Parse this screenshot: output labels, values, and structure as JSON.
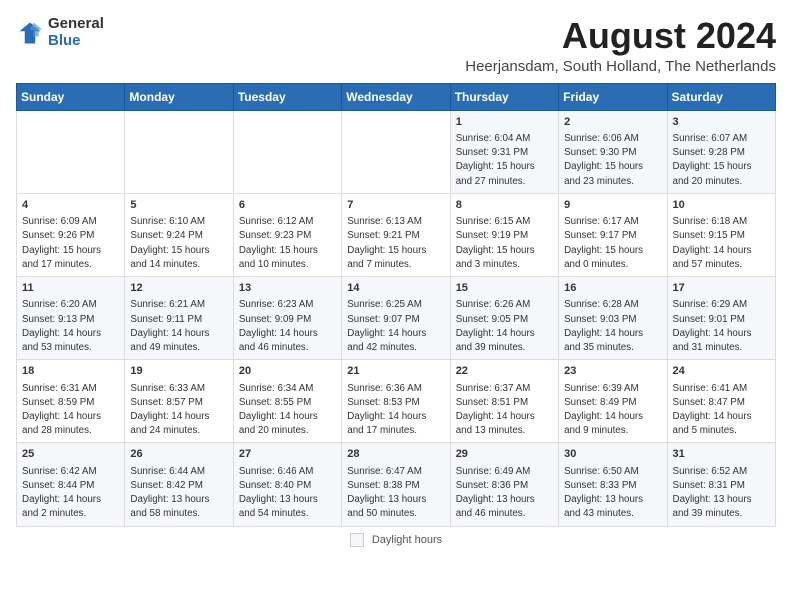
{
  "header": {
    "logo_general": "General",
    "logo_blue": "Blue",
    "month_title": "August 2024",
    "subtitle": "Heerjansdam, South Holland, The Netherlands"
  },
  "calendar": {
    "columns": [
      "Sunday",
      "Monday",
      "Tuesday",
      "Wednesday",
      "Thursday",
      "Friday",
      "Saturday"
    ],
    "weeks": [
      [
        {
          "day": "",
          "info": ""
        },
        {
          "day": "",
          "info": ""
        },
        {
          "day": "",
          "info": ""
        },
        {
          "day": "",
          "info": ""
        },
        {
          "day": "1",
          "info": "Sunrise: 6:04 AM\nSunset: 9:31 PM\nDaylight: 15 hours\nand 27 minutes."
        },
        {
          "day": "2",
          "info": "Sunrise: 6:06 AM\nSunset: 9:30 PM\nDaylight: 15 hours\nand 23 minutes."
        },
        {
          "day": "3",
          "info": "Sunrise: 6:07 AM\nSunset: 9:28 PM\nDaylight: 15 hours\nand 20 minutes."
        }
      ],
      [
        {
          "day": "4",
          "info": "Sunrise: 6:09 AM\nSunset: 9:26 PM\nDaylight: 15 hours\nand 17 minutes."
        },
        {
          "day": "5",
          "info": "Sunrise: 6:10 AM\nSunset: 9:24 PM\nDaylight: 15 hours\nand 14 minutes."
        },
        {
          "day": "6",
          "info": "Sunrise: 6:12 AM\nSunset: 9:23 PM\nDaylight: 15 hours\nand 10 minutes."
        },
        {
          "day": "7",
          "info": "Sunrise: 6:13 AM\nSunset: 9:21 PM\nDaylight: 15 hours\nand 7 minutes."
        },
        {
          "day": "8",
          "info": "Sunrise: 6:15 AM\nSunset: 9:19 PM\nDaylight: 15 hours\nand 3 minutes."
        },
        {
          "day": "9",
          "info": "Sunrise: 6:17 AM\nSunset: 9:17 PM\nDaylight: 15 hours\nand 0 minutes."
        },
        {
          "day": "10",
          "info": "Sunrise: 6:18 AM\nSunset: 9:15 PM\nDaylight: 14 hours\nand 57 minutes."
        }
      ],
      [
        {
          "day": "11",
          "info": "Sunrise: 6:20 AM\nSunset: 9:13 PM\nDaylight: 14 hours\nand 53 minutes."
        },
        {
          "day": "12",
          "info": "Sunrise: 6:21 AM\nSunset: 9:11 PM\nDaylight: 14 hours\nand 49 minutes."
        },
        {
          "day": "13",
          "info": "Sunrise: 6:23 AM\nSunset: 9:09 PM\nDaylight: 14 hours\nand 46 minutes."
        },
        {
          "day": "14",
          "info": "Sunrise: 6:25 AM\nSunset: 9:07 PM\nDaylight: 14 hours\nand 42 minutes."
        },
        {
          "day": "15",
          "info": "Sunrise: 6:26 AM\nSunset: 9:05 PM\nDaylight: 14 hours\nand 39 minutes."
        },
        {
          "day": "16",
          "info": "Sunrise: 6:28 AM\nSunset: 9:03 PM\nDaylight: 14 hours\nand 35 minutes."
        },
        {
          "day": "17",
          "info": "Sunrise: 6:29 AM\nSunset: 9:01 PM\nDaylight: 14 hours\nand 31 minutes."
        }
      ],
      [
        {
          "day": "18",
          "info": "Sunrise: 6:31 AM\nSunset: 8:59 PM\nDaylight: 14 hours\nand 28 minutes."
        },
        {
          "day": "19",
          "info": "Sunrise: 6:33 AM\nSunset: 8:57 PM\nDaylight: 14 hours\nand 24 minutes."
        },
        {
          "day": "20",
          "info": "Sunrise: 6:34 AM\nSunset: 8:55 PM\nDaylight: 14 hours\nand 20 minutes."
        },
        {
          "day": "21",
          "info": "Sunrise: 6:36 AM\nSunset: 8:53 PM\nDaylight: 14 hours\nand 17 minutes."
        },
        {
          "day": "22",
          "info": "Sunrise: 6:37 AM\nSunset: 8:51 PM\nDaylight: 14 hours\nand 13 minutes."
        },
        {
          "day": "23",
          "info": "Sunrise: 6:39 AM\nSunset: 8:49 PM\nDaylight: 14 hours\nand 9 minutes."
        },
        {
          "day": "24",
          "info": "Sunrise: 6:41 AM\nSunset: 8:47 PM\nDaylight: 14 hours\nand 5 minutes."
        }
      ],
      [
        {
          "day": "25",
          "info": "Sunrise: 6:42 AM\nSunset: 8:44 PM\nDaylight: 14 hours\nand 2 minutes."
        },
        {
          "day": "26",
          "info": "Sunrise: 6:44 AM\nSunset: 8:42 PM\nDaylight: 13 hours\nand 58 minutes."
        },
        {
          "day": "27",
          "info": "Sunrise: 6:46 AM\nSunset: 8:40 PM\nDaylight: 13 hours\nand 54 minutes."
        },
        {
          "day": "28",
          "info": "Sunrise: 6:47 AM\nSunset: 8:38 PM\nDaylight: 13 hours\nand 50 minutes."
        },
        {
          "day": "29",
          "info": "Sunrise: 6:49 AM\nSunset: 8:36 PM\nDaylight: 13 hours\nand 46 minutes."
        },
        {
          "day": "30",
          "info": "Sunrise: 6:50 AM\nSunset: 8:33 PM\nDaylight: 13 hours\nand 43 minutes."
        },
        {
          "day": "31",
          "info": "Sunrise: 6:52 AM\nSunset: 8:31 PM\nDaylight: 13 hours\nand 39 minutes."
        }
      ]
    ]
  },
  "footer": {
    "legend_label": "Daylight hours"
  }
}
